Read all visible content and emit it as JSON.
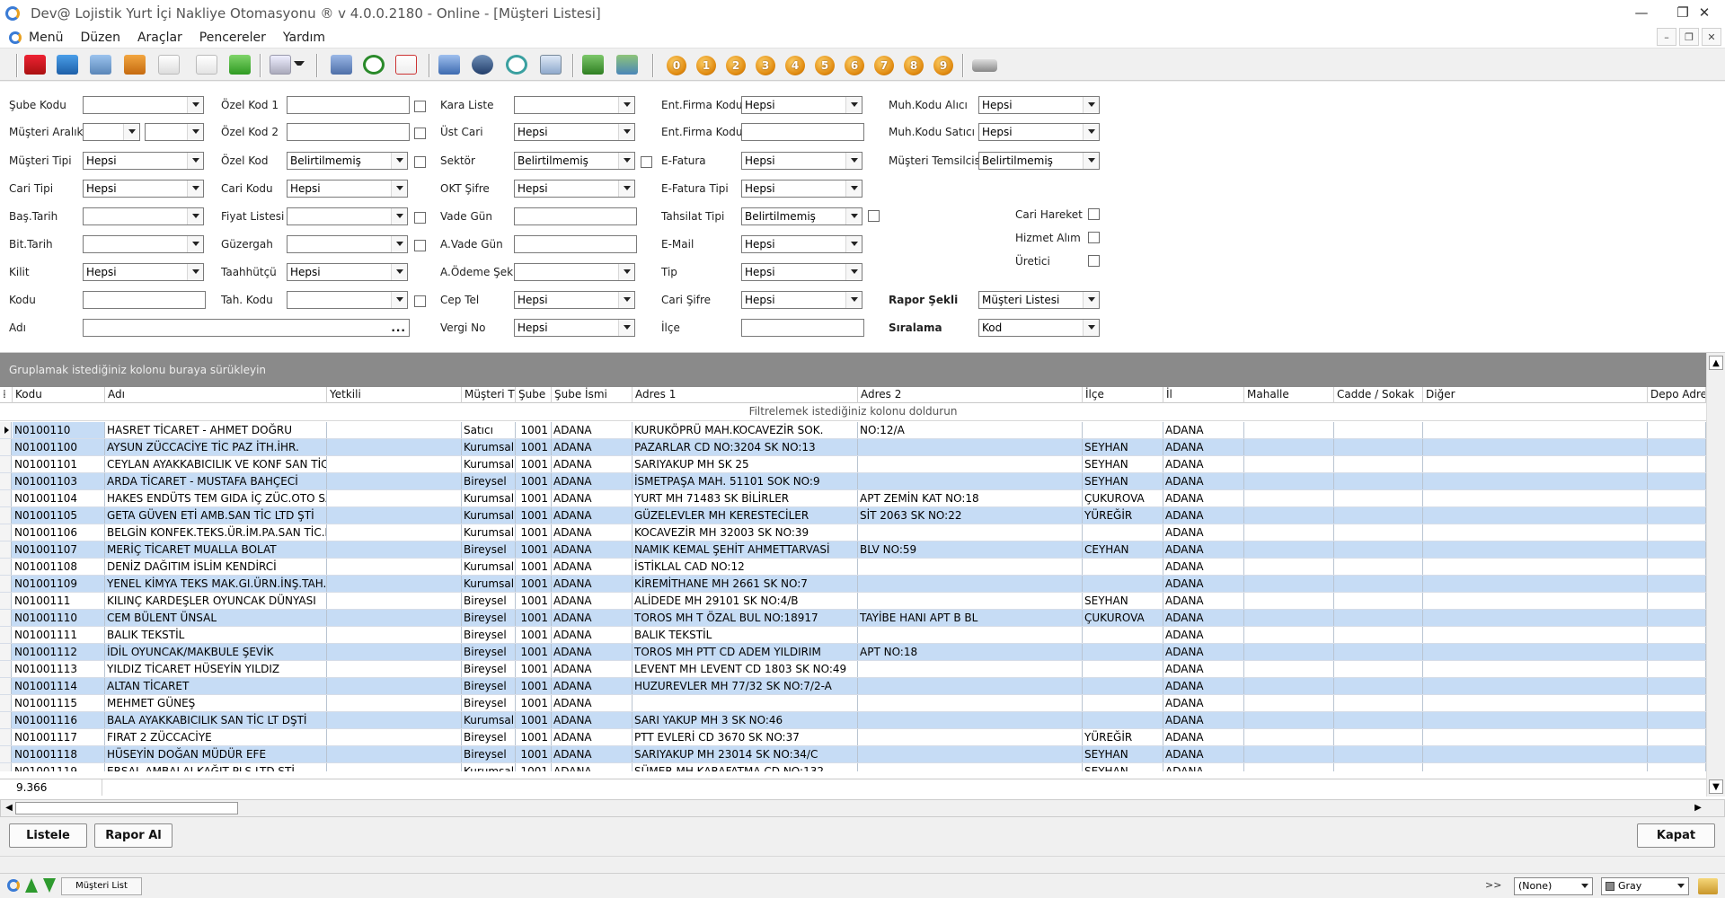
{
  "window": {
    "title": "Dev@ Lojistik Yurt İçi Nakliye Otomasyonu ® v 4.0.0.2180 - Online - [Müşteri Listesi]",
    "minimize": "—",
    "maximize": "❐",
    "close": "✕"
  },
  "menu": {
    "items": [
      "Menü",
      "Düzen",
      "Araçlar",
      "Pencereler",
      "Yardım"
    ],
    "mdi": [
      "–",
      "❐",
      "✕"
    ]
  },
  "toolbar": {
    "coins": [
      "0",
      "1",
      "2",
      "3",
      "4",
      "5",
      "6",
      "7",
      "8",
      "9"
    ],
    "icons": [
      "truck-icon",
      "folder-icon",
      "report-icon",
      "users-icon",
      "document-edit-icon",
      "page-icon",
      "open-folder-icon",
      "checklist-icon",
      "book-icon",
      "clock-icon",
      "calendar-icon",
      "hierarchy-icon",
      "group-icon",
      "refresh-icon",
      "monitor-icon",
      "transfer-icon",
      "exit-icon",
      "car-icon"
    ]
  },
  "filters": {
    "col1": {
      "sube_kodu": {
        "label": "Şube Kodu",
        "value": ""
      },
      "musteri_aralik": {
        "label": "Müşteri Aralık",
        "value1": "",
        "value2": ""
      },
      "musteri_tipi": {
        "label": "Müşteri Tipi",
        "value": "Hepsi"
      },
      "cari_tipi": {
        "label": "Cari Tipi",
        "value": "Hepsi"
      },
      "bas_tarih": {
        "label": "Baş.Tarih",
        "value": ""
      },
      "bit_tarih": {
        "label": "Bit.Tarih",
        "value": ""
      },
      "kilit": {
        "label": "Kilit",
        "value": "Hepsi"
      },
      "kodu": {
        "label": "Kodu",
        "value": ""
      },
      "adi": {
        "label": "Adı",
        "value": "",
        "ellipsis": "..."
      }
    },
    "col2": {
      "ozel_kod_1": {
        "label": "Özel Kod 1",
        "value": ""
      },
      "ozel_kod_2": {
        "label": "Özel Kod 2",
        "value": ""
      },
      "ozel_kod": {
        "label": "Özel Kod",
        "value": "Belirtilmemiş"
      },
      "cari_kodu": {
        "label": "Cari Kodu",
        "value": "Hepsi"
      },
      "fiyat_listesi": {
        "label": "Fiyat Listesi",
        "value": ""
      },
      "guzergah": {
        "label": "Güzergah",
        "value": ""
      },
      "taahhutcu": {
        "label": "Taahhütçü",
        "value": "Hepsi"
      },
      "tah_kodu": {
        "label": "Tah. Kodu",
        "value": ""
      }
    },
    "col3": {
      "kara_liste": {
        "label": "Kara Liste",
        "value": ""
      },
      "ust_cari": {
        "label": "Üst Cari",
        "value": "Hepsi"
      },
      "sektor": {
        "label": "Sektör",
        "value": "Belirtilmemiş"
      },
      "okt_sifre": {
        "label": "OKT Şifre",
        "value": "Hepsi"
      },
      "vade_gun": {
        "label": "Vade Gün",
        "value": ""
      },
      "a_vade_gun": {
        "label": "A.Vade Gün",
        "value": ""
      },
      "a_odeme_sekli": {
        "label": "A.Ödeme Şekli",
        "value": ""
      },
      "cep_tel": {
        "label": "Cep Tel",
        "value": "Hepsi"
      },
      "vergi_no": {
        "label": "Vergi No",
        "value": "Hepsi"
      }
    },
    "col4": {
      "ent_firma_kodu_1": {
        "label": "Ent.Firma Kodu",
        "value": "Hepsi"
      },
      "ent_firma_kodu_2": {
        "label": "Ent.Firma Kodu",
        "value": ""
      },
      "e_fatura": {
        "label": "E-Fatura",
        "value": "Hepsi"
      },
      "e_fatura_tipi": {
        "label": "E-Fatura Tipi",
        "value": "Hepsi"
      },
      "tahsilat_tipi": {
        "label": "Tahsilat Tipi",
        "value": "Belirtilmemiş"
      },
      "e_mail": {
        "label": "E-Mail",
        "value": "Hepsi"
      },
      "tip": {
        "label": "Tip",
        "value": "Hepsi"
      },
      "cari_sifre": {
        "label": "Cari Şifre",
        "value": "Hepsi"
      },
      "ilce": {
        "label": "İlçe",
        "value": ""
      }
    },
    "col5": {
      "muh_kodu_alici": {
        "label": "Muh.Kodu Alıcı",
        "value": "Hepsi"
      },
      "muh_kodu_satici": {
        "label": "Muh.Kodu Satıcı",
        "value": "Hepsi"
      },
      "musteri_temsilcisi": {
        "label": "Müşteri Temsilcisi",
        "value": "Belirtilmemiş"
      },
      "cari_hareket": {
        "label": "Cari Hareket"
      },
      "hizmet_alim": {
        "label": "Hizmet Alım"
      },
      "uretici": {
        "label": "Üretici"
      },
      "rapor_sekli": {
        "label": "Rapor Şekli",
        "value": "Müşteri Listesi"
      },
      "siralama": {
        "label": "Sıralama",
        "value": "Kod"
      }
    }
  },
  "grid": {
    "group_panel": "Gruplamak istediğiniz kolonu buraya sürükleyin",
    "filter_hint": "Filtrelemek istediğiniz kolonu doldurun",
    "columns": [
      "Kodu",
      "Adı",
      "Yetkili",
      "Müşteri Ti",
      "Şube",
      "Şube İsmi",
      "Adres 1",
      "Adres 2",
      "İlçe",
      "İl",
      "Mahalle",
      "Cadde / Sokak",
      "Diğer",
      "Depo Adre"
    ],
    "rows": [
      [
        "N0100110",
        "HASRET TİCARET - AHMET DOĞRU",
        "",
        "Satıcı",
        "1001",
        "ADANA",
        "KURUKÖPRÜ MAH.KOCAVEZİR SOK.",
        "NO:12/A",
        "",
        "ADANA"
      ],
      [
        "N01001100",
        "AYSUN ZÜCCACİYE TİC PAZ İTH.İHR.",
        "",
        "Kurumsal",
        "1001",
        "ADANA",
        "PAZARLAR CD NO:3204 SK NO:13",
        "",
        "SEYHAN",
        "ADANA"
      ],
      [
        "N01001101",
        "CEYLAN AYAKKABICILIK VE KONF SAN TİC LTD",
        "",
        "Kurumsal",
        "1001",
        "ADANA",
        "SARIYAKUP MH SK 25",
        "",
        "SEYHAN",
        "ADANA"
      ],
      [
        "N01001103",
        "ARDA TİCARET - MUSTAFA BAHÇECİ",
        "",
        "Bireysel",
        "1001",
        "ADANA",
        "İSMETPAŞA MAH. 51101 SOK NO:9",
        "",
        "SEYHAN",
        "ADANA"
      ],
      [
        "N01001104",
        "HAKES ENDÜTS TEM GIDA İÇ ZÜC.OTO SAN",
        "",
        "Kurumsal",
        "1001",
        "ADANA",
        "YURT MH 71483 SK BİLİRLER",
        "APT ZEMİN KAT NO:18",
        "ÇUKUROVA",
        "ADANA"
      ],
      [
        "N01001105",
        "GETA GÜVEN ETİ AMB.SAN TİC LTD ŞTİ",
        "",
        "Kurumsal",
        "1001",
        "ADANA",
        "GÜZELEVLER MH KERESTECİLER",
        "SİT 2063 SK NO:22",
        "YÜREĞİR",
        "ADANA"
      ],
      [
        "N01001106",
        "BELGİN KONFEK.TEKS.ÜR.İM.PA.SAN TİC.LTD",
        "",
        "Kurumsal",
        "1001",
        "ADANA",
        "KOCAVEZİR MH 32003 SK NO:39",
        "",
        "",
        "ADANA"
      ],
      [
        "N01001107",
        "MERİÇ TİCARET MUALLA BOLAT",
        "",
        "Bireysel",
        "1001",
        "ADANA",
        "NAMIK KEMAL ŞEHİT AHMETTARVASİ",
        "BLV NO:59",
        "CEYHAN",
        "ADANA"
      ],
      [
        "N01001108",
        "DENİZ DAĞITIM İSLİM KENDİRCİ",
        "",
        "Kurumsal",
        "1001",
        "ADANA",
        "İSTİKLAL CAD NO:12",
        "",
        "",
        "ADANA"
      ],
      [
        "N01001109",
        "YENEL KİMYA TEKS MAK.GI.ÜRN.İNŞ.TAH.LTD",
        "",
        "Kurumsal",
        "1001",
        "ADANA",
        "KİREMİTHANE MH 2661 SK NO:7",
        "",
        "",
        "ADANA"
      ],
      [
        "N0100111",
        "KILINÇ KARDEŞLER OYUNCAK DÜNYASI",
        "",
        "Bireysel",
        "1001",
        "ADANA",
        "ALİDEDE MH 29101 SK NO:4/B",
        "",
        "SEYHAN",
        "ADANA"
      ],
      [
        "N01001110",
        "CEM BÜLENT ÜNSAL",
        "",
        "Bireysel",
        "1001",
        "ADANA",
        "TOROS MH T ÖZAL BUL NO:18917",
        "TAYİBE HANI APT B BL",
        "ÇUKUROVA",
        "ADANA"
      ],
      [
        "N01001111",
        "BALIK TEKSTİL",
        "",
        "Bireysel",
        "1001",
        "ADANA",
        "BALIK TEKSTİL",
        "",
        "",
        "ADANA"
      ],
      [
        "N01001112",
        "İDİL OYUNCAK/MAKBULE ŞEVİK",
        "",
        "Bireysel",
        "1001",
        "ADANA",
        "TOROS MH PTT CD ADEM YILDIRIM",
        "APT NO:18",
        "",
        "ADANA"
      ],
      [
        "N01001113",
        "YILDIZ TİCARET HÜSEYİN YILDIZ",
        "",
        "Bireysel",
        "1001",
        "ADANA",
        "LEVENT MH LEVENT CD 1803 SK NO:49",
        "",
        "",
        "ADANA"
      ],
      [
        "N01001114",
        "ALTAN TİCARET",
        "",
        "Bireysel",
        "1001",
        "ADANA",
        "HUZUREVLER MH 77/32 SK NO:7/2-A",
        "",
        "",
        "ADANA"
      ],
      [
        "N01001115",
        "MEHMET GÜNEŞ",
        "",
        "Bireysel",
        "1001",
        "ADANA",
        "",
        "",
        "",
        "ADANA"
      ],
      [
        "N01001116",
        "BALA AYAKKABICILIK SAN TİC LT DŞTİ",
        "",
        "Kurumsal",
        "1001",
        "ADANA",
        "SARI YAKUP MH 3 SK NO:46",
        "",
        "",
        "ADANA"
      ],
      [
        "N01001117",
        "FIRAT 2 ZÜCCACİYE",
        "",
        "Bireysel",
        "1001",
        "ADANA",
        "PTT EVLERİ CD 3670 SK NO:37",
        "",
        "YÜREĞİR",
        "ADANA"
      ],
      [
        "N01001118",
        "HÜSEYİN DOĞAN MÜDÜR EFE",
        "",
        "Bireysel",
        "1001",
        "ADANA",
        "SARIYAKUP MH 23014 SK NO:34/C",
        "",
        "SEYHAN",
        "ADANA"
      ],
      [
        "N01001119",
        "ERSAL AMBALAJ KAĞIT PLS LTD ŞTİ",
        "",
        "Kurumsal",
        "1001",
        "ADANA",
        "SÜMER MH KARAFATMA CD NO:132",
        "",
        "SEYHAN",
        "ADANA"
      ]
    ],
    "record_count": "9.366"
  },
  "buttons": {
    "listele": "Listele",
    "rapor_al": "Rapor Al",
    "kapat": "Kapat"
  },
  "taskbar": {
    "tab": "Müşteri List",
    "expand": ">>",
    "layout_select": "(None)",
    "color_select": "Gray"
  }
}
